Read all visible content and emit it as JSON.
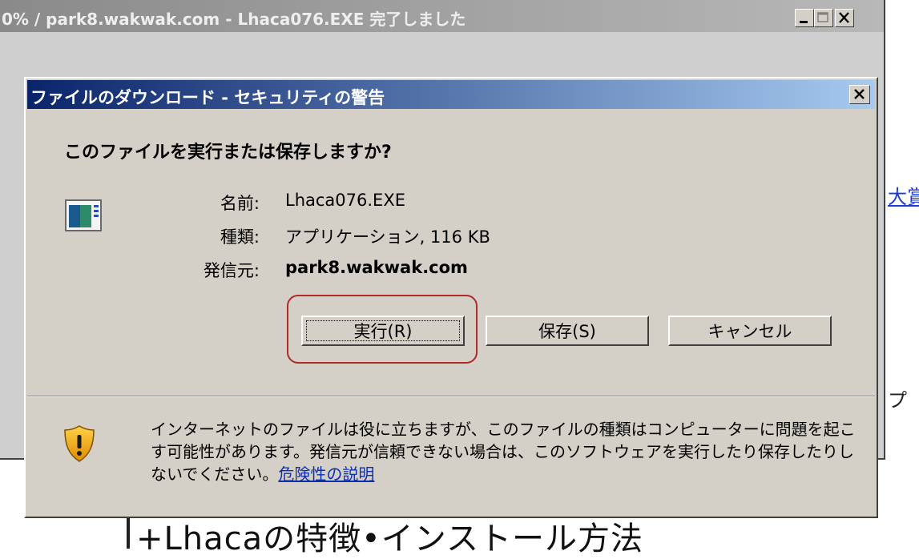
{
  "background_page": {
    "link_fragment": "大賞",
    "text_fragment": "プ",
    "heading": "+Lhacaの特徴•インストール方法"
  },
  "parent_window": {
    "title": "0% / park8.wakwak.com - Lhaca076.EXE 完了しました",
    "controls": {
      "minimize_icon": "minimize-icon",
      "maximize_icon": "maximize-icon",
      "close_icon": "close-icon"
    }
  },
  "dialog": {
    "title": "ファイルのダウンロード - セキュリティの警告",
    "question": "このファイルを実行または保存しますか?",
    "file_icon": "application-file-icon",
    "fields": {
      "name_label": "名前:",
      "name_value": "Lhaca076.EXE",
      "type_label": "種類:",
      "type_value": "アプリケーション, 116 KB",
      "from_label": "発信元:",
      "from_value": "park8.wakwak.com"
    },
    "buttons": {
      "run": "実行(R)",
      "save": "保存(S)",
      "cancel": "キャンセル"
    },
    "warning_icon": "security-shield-icon",
    "warning_text": "インターネットのファイルは役に立ちますが、このファイルの種類はコンピューターに問題を起こす可能性があります。発信元が信頼できない場合は、このソフトウェアを実行したり保存したりしないでください。",
    "warning_link": "危険性の説明"
  },
  "colors": {
    "dialog_title_start": "#0a246a",
    "dialog_title_end": "#a6caf0",
    "highlight": "#b02a2a",
    "link": "#0b2fb0"
  }
}
